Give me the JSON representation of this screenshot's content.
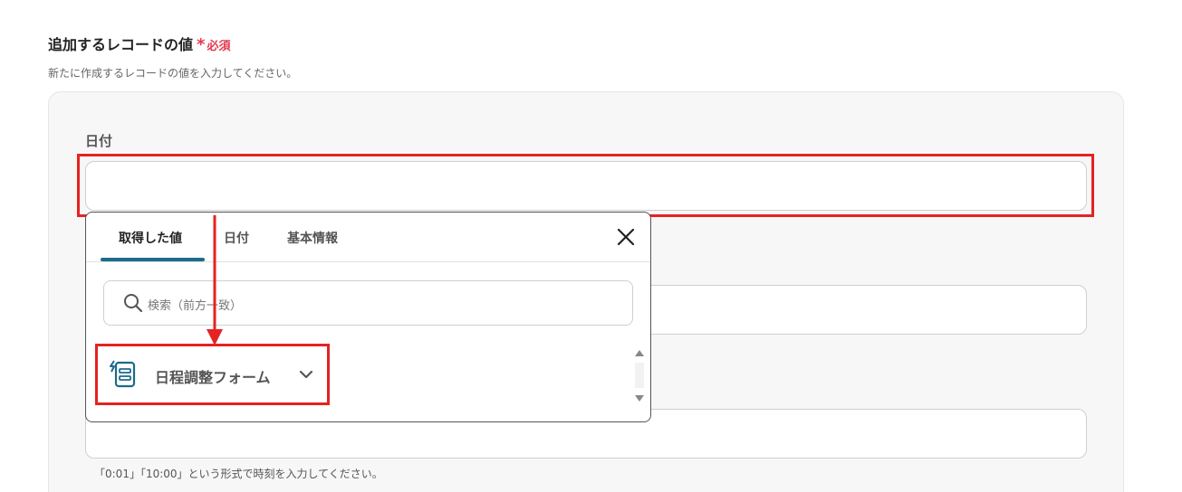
{
  "section": {
    "title": "追加するレコードの値",
    "required_star": "*",
    "required_label": "必須",
    "description": "新たに作成するレコードの値を入力してください。"
  },
  "date_field": {
    "label": "日付",
    "value": ""
  },
  "time_field": {
    "hint": "「0:01」「10:00」という形式で時刻を入力してください。"
  },
  "popup": {
    "tabs": [
      {
        "label": "取得した値",
        "active": true
      },
      {
        "label": "日付",
        "active": false
      },
      {
        "label": "基本情報",
        "active": false
      }
    ],
    "search_placeholder": "検索（前方一致）",
    "items": [
      {
        "label": "日程調整フォーム",
        "icon": "form-icon"
      }
    ]
  },
  "colors": {
    "highlight": "#e52222",
    "required": "#e53950",
    "tab_active": "#1c6b8a"
  }
}
